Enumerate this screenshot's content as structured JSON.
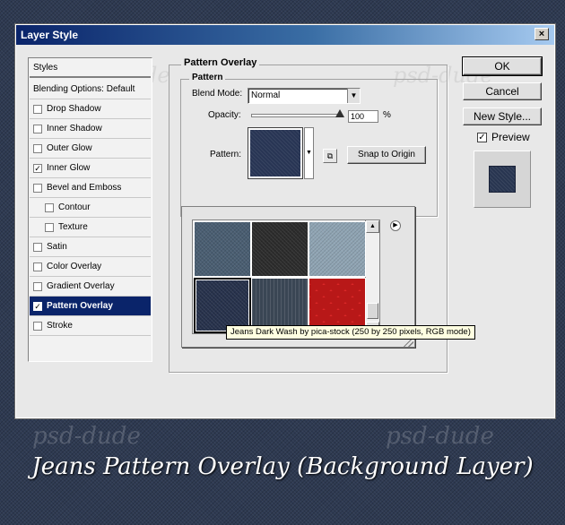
{
  "window": {
    "title": "Layer Style",
    "close_glyph": "×"
  },
  "styles_list": {
    "header": "Styles",
    "items": [
      {
        "label": "Blending Options: Default",
        "checkbox": false,
        "checked": false,
        "selected": false
      },
      {
        "label": "Drop Shadow",
        "checkbox": true,
        "checked": false,
        "selected": false
      },
      {
        "label": "Inner Shadow",
        "checkbox": true,
        "checked": false,
        "selected": false
      },
      {
        "label": "Outer Glow",
        "checkbox": true,
        "checked": false,
        "selected": false
      },
      {
        "label": "Inner Glow",
        "checkbox": true,
        "checked": true,
        "selected": false
      },
      {
        "label": "Bevel and Emboss",
        "checkbox": true,
        "checked": false,
        "selected": false
      },
      {
        "label": "Contour",
        "checkbox": true,
        "checked": false,
        "selected": false,
        "indent": true
      },
      {
        "label": "Texture",
        "checkbox": true,
        "checked": false,
        "selected": false,
        "indent": true
      },
      {
        "label": "Satin",
        "checkbox": true,
        "checked": false,
        "selected": false
      },
      {
        "label": "Color Overlay",
        "checkbox": true,
        "checked": false,
        "selected": false
      },
      {
        "label": "Gradient Overlay",
        "checkbox": true,
        "checked": false,
        "selected": false
      },
      {
        "label": "Pattern Overlay",
        "checkbox": true,
        "checked": true,
        "selected": true
      },
      {
        "label": "Stroke",
        "checkbox": true,
        "checked": false,
        "selected": false
      }
    ]
  },
  "buttons": {
    "ok": "OK",
    "cancel": "Cancel",
    "new_style": "New Style...",
    "preview_label": "Preview",
    "preview_checked": true
  },
  "pattern_overlay": {
    "group_title": "Pattern Overlay",
    "inner_title": "Pattern",
    "blend_mode_label": "Blend Mode:",
    "blend_mode_value": "Normal",
    "opacity_label": "Opacity:",
    "opacity_value": "100",
    "opacity_unit": "%",
    "opacity_level": 1.0,
    "pattern_label": "Pattern:",
    "snap_button": "Snap to Origin"
  },
  "picker": {
    "tiles": [
      {
        "name": "steel-blue",
        "color": "#4a5e72"
      },
      {
        "name": "dark-charcoal",
        "color": "#2c2c2c"
      },
      {
        "name": "light-denim",
        "color": "#8fa4b3"
      },
      {
        "name": "jeans-dark-wash",
        "color": "#27324c",
        "selected": true
      },
      {
        "name": "dark-stripes",
        "color": "#3a4654"
      },
      {
        "name": "red-scales",
        "color": "#e02a2a"
      }
    ],
    "tooltip": "Jeans Dark Wash by pica-stock (250 by 250 pixels, RGB mode)"
  },
  "watermarks": {
    "text": "psd-dude"
  },
  "caption": "Jeans Pattern Overlay (Background Layer)",
  "colors": {
    "title_bar_start": "#0a246a",
    "selection": "#0a246a",
    "background_denim": "#2e3a52"
  }
}
